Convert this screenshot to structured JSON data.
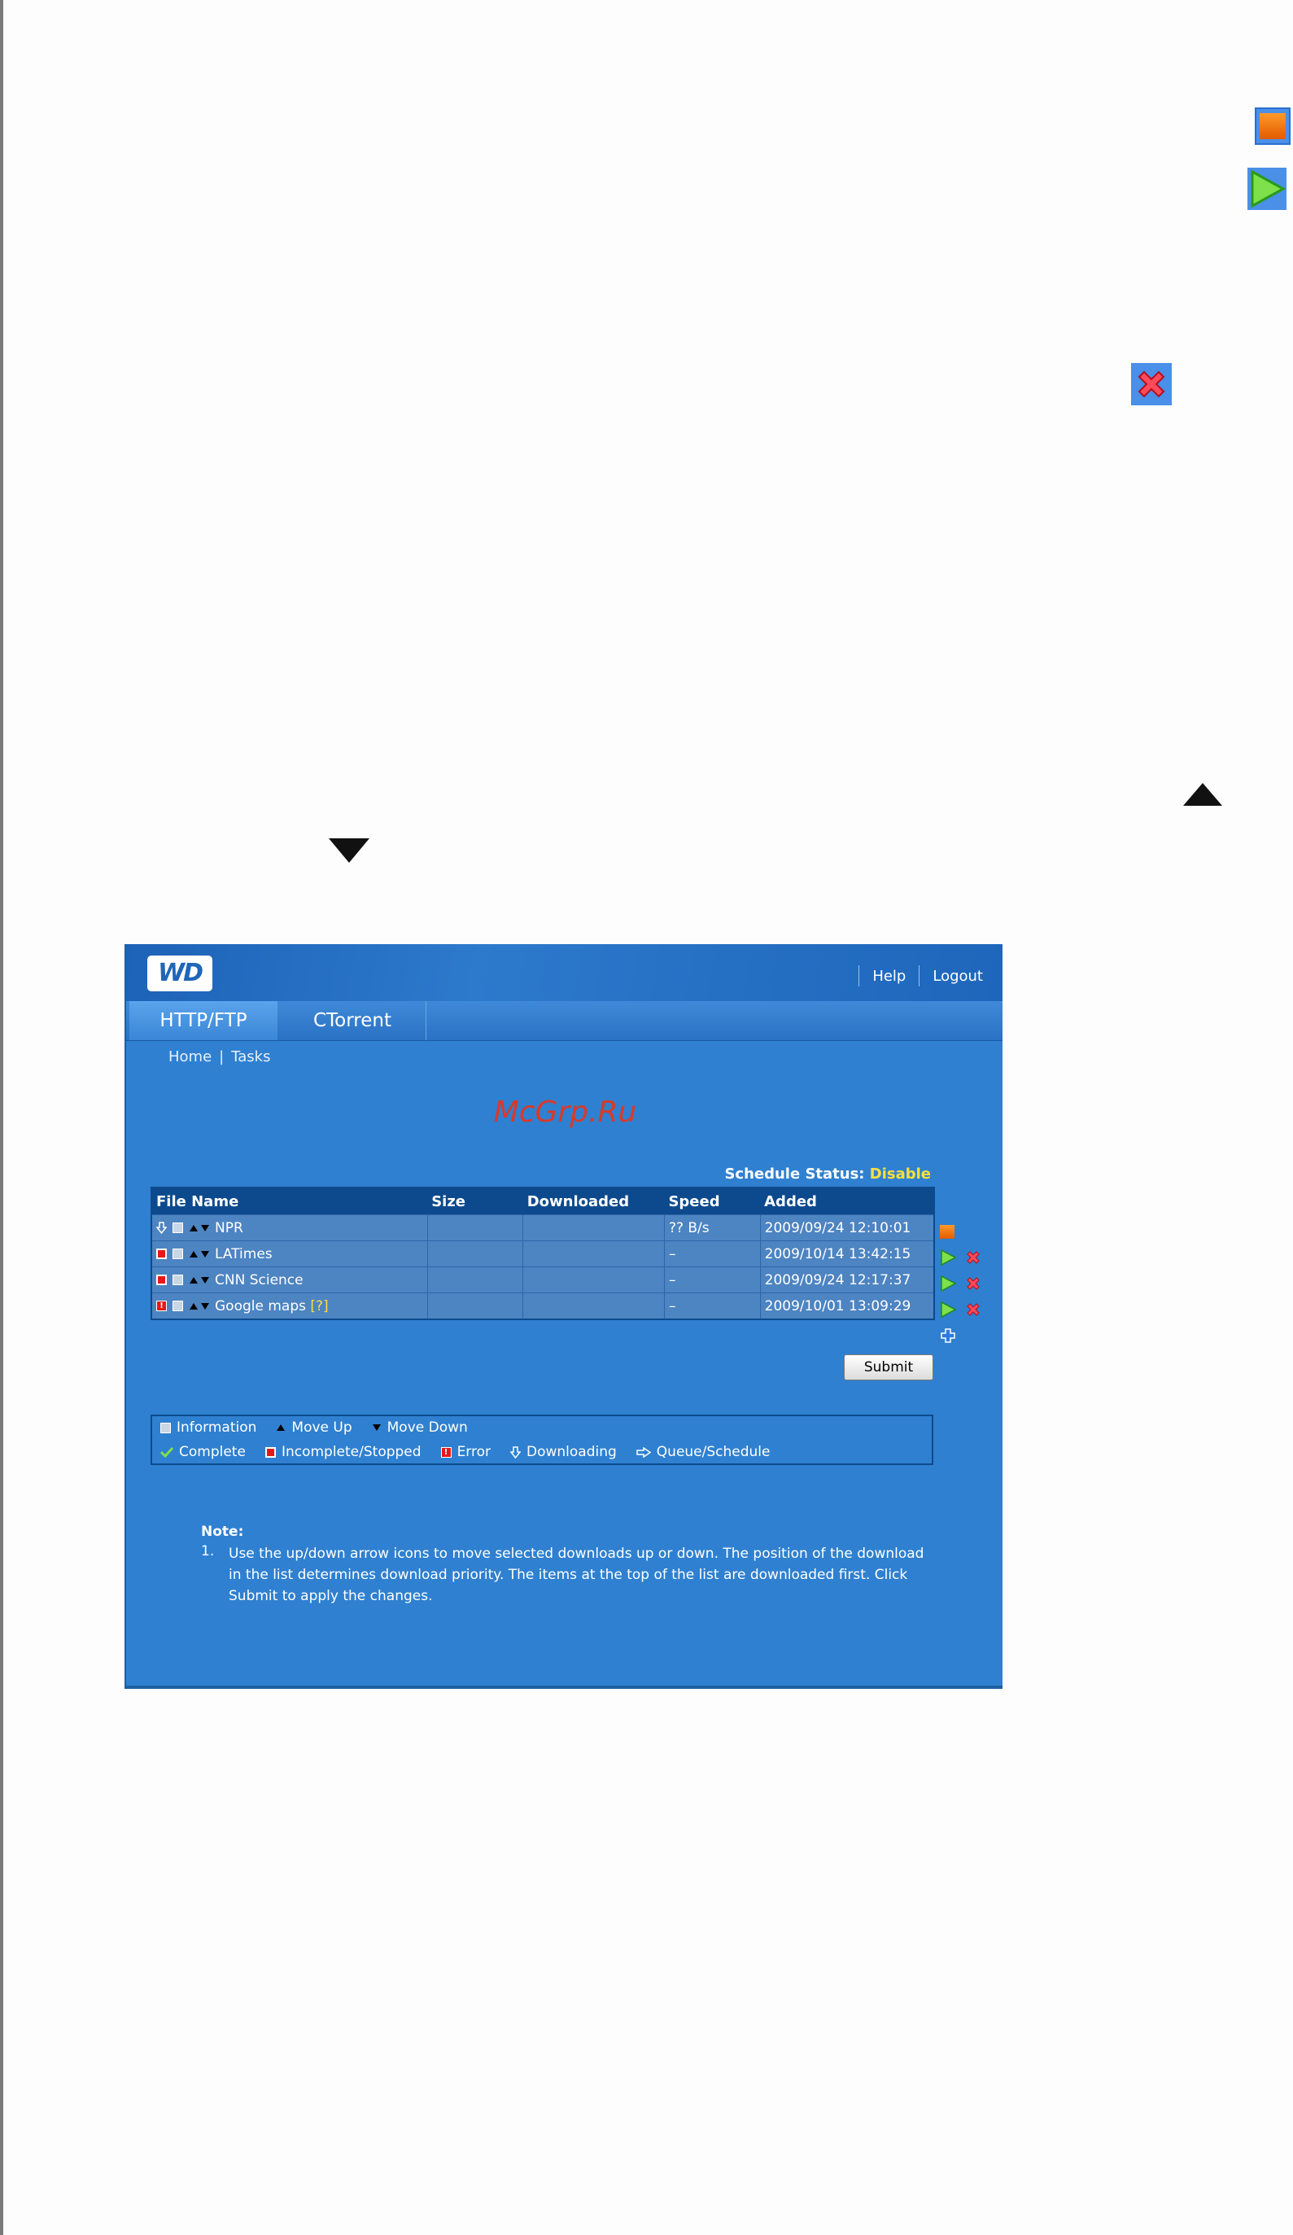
{
  "header": {
    "help": "Help",
    "logout": "Logout",
    "logo": "WD"
  },
  "tabs": [
    "HTTP/FTP",
    "CTorrent"
  ],
  "breadcrumb": {
    "home": "Home",
    "separator": "|",
    "current": "Tasks"
  },
  "watermark": "McGrp.Ru",
  "schedule": {
    "label": "Schedule Status:",
    "value": "Disable"
  },
  "table": {
    "headers": [
      "File Name",
      "Size",
      "Downloaded",
      "Speed",
      "Added"
    ],
    "rows": [
      {
        "status": "downloading",
        "name": "NPR",
        "size": "",
        "downloaded": "",
        "speed": "?? B/s",
        "added": "2009/09/24 12:10:01"
      },
      {
        "status": "incomplete",
        "name": "LATimes",
        "size": "",
        "downloaded": "",
        "speed": "–",
        "added": "2009/10/14 13:42:15"
      },
      {
        "status": "incomplete",
        "name": "CNN Science",
        "size": "",
        "downloaded": "",
        "speed": "–",
        "added": "2009/09/24 12:17:37"
      },
      {
        "status": "error",
        "name": "Google maps",
        "help": "[?]",
        "size": "",
        "downloaded": "",
        "speed": "–",
        "added": "2009/10/01 13:09:29"
      }
    ]
  },
  "submit_label": "Submit",
  "legend": {
    "information": "Information",
    "move_up": "Move Up",
    "move_down": "Move Down",
    "complete": "Complete",
    "incomplete": "Incomplete/Stopped",
    "error": "Error",
    "downloading": "Downloading",
    "queue": "Queue/Schedule"
  },
  "note": {
    "title": "Note:",
    "items": [
      {
        "num": "1.",
        "text": "Use the up/down arrow icons to move selected downloads up or down. The position of the download in the list determines download priority. The items at the top of the list are downloaded first. Click Submit to apply the changes."
      }
    ]
  },
  "colors": {
    "background": "#2f80d0",
    "header": "#0d4a8d",
    "accent_yellow": "#ffe03a",
    "watermark": "#d83a2a"
  }
}
